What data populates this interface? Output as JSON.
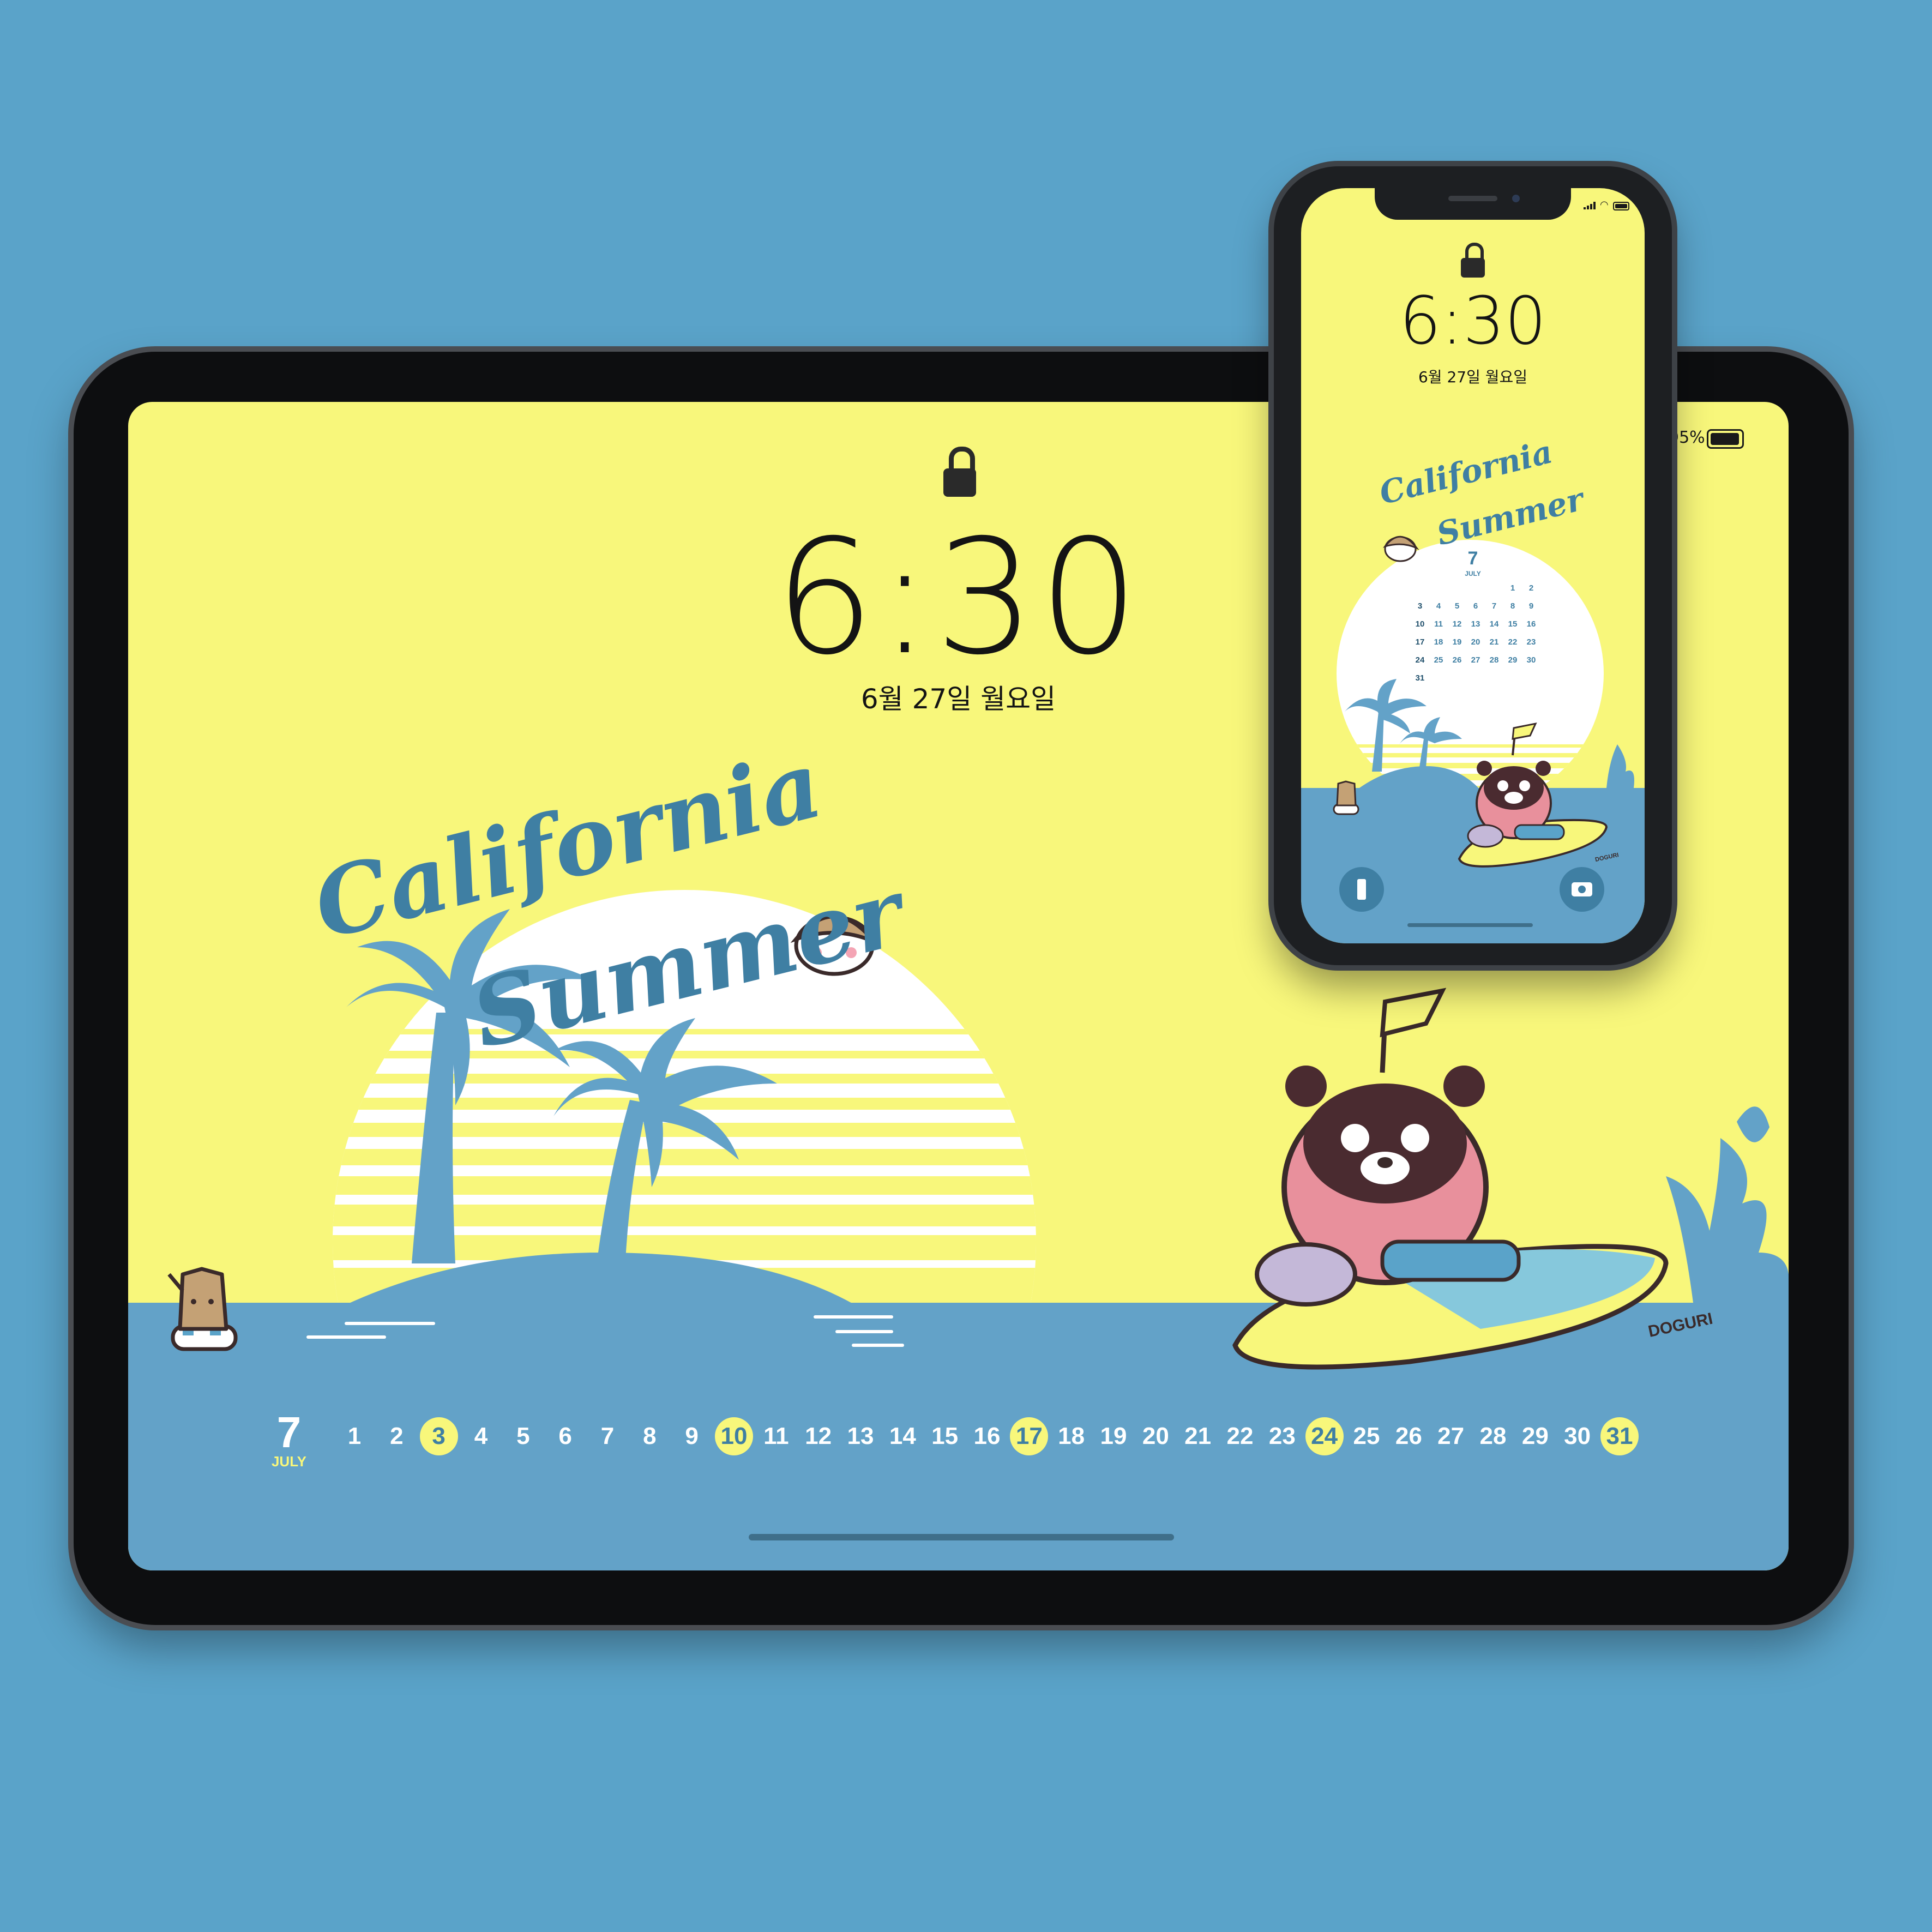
{
  "colors": {
    "background": "#5aa3c9",
    "wallpaper_yellow": "#f8f77b",
    "ocean_blue": "#63a2c8",
    "text_blue": "#3f7fa3",
    "dark": "#141414"
  },
  "tablet": {
    "status": {
      "battery": "95%"
    },
    "lockscreen": {
      "lock_icon": "lock-icon",
      "time": "6:30",
      "date": "6월 27일 월요일"
    },
    "artwork": {
      "title_line1": "California",
      "title_line2": "Summer",
      "brand": "DOGURI"
    },
    "calendar": {
      "month_number": "7",
      "month_name": "JULY",
      "days": [
        "1",
        "2",
        "3",
        "4",
        "5",
        "6",
        "7",
        "8",
        "9",
        "10",
        "11",
        "12",
        "13",
        "14",
        "15",
        "16",
        "17",
        "18",
        "19",
        "20",
        "21",
        "22",
        "23",
        "24",
        "25",
        "26",
        "27",
        "28",
        "29",
        "30",
        "31"
      ],
      "highlighted": [
        "3",
        "10",
        "17",
        "24",
        "31"
      ]
    }
  },
  "phone": {
    "status": {
      "signal_icon": "signal-icon",
      "wifi_icon": "wifi-icon",
      "battery_icon": "battery-icon"
    },
    "lockscreen": {
      "lock_icon": "lock-icon",
      "time": "6:30",
      "date": "6월 27일 월요일"
    },
    "artwork": {
      "title_line1": "California",
      "title_line2": "Summer",
      "brand": "DOGURI"
    },
    "calendar": {
      "month_number": "7",
      "month_name": "JULY",
      "weeks": [
        [
          "",
          "",
          "",
          "",
          "",
          "1",
          "2"
        ],
        [
          "3",
          "4",
          "5",
          "6",
          "7",
          "8",
          "9"
        ],
        [
          "10",
          "11",
          "12",
          "13",
          "14",
          "15",
          "16"
        ],
        [
          "17",
          "18",
          "19",
          "20",
          "21",
          "22",
          "23"
        ],
        [
          "24",
          "25",
          "26",
          "27",
          "28",
          "29",
          "30"
        ],
        [
          "31",
          "",
          "",
          "",
          "",
          "",
          ""
        ]
      ]
    },
    "controls": {
      "flashlight_icon": "flashlight-icon",
      "camera_icon": "camera-icon"
    }
  }
}
